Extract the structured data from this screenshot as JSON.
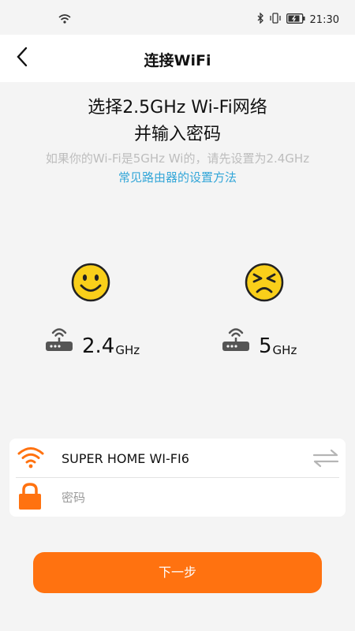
{
  "status_bar": {
    "time": "21:30",
    "icons": [
      "wifi-icon",
      "bluetooth-icon",
      "vibrate-icon",
      "battery-charging-icon"
    ]
  },
  "nav": {
    "title": "连接WiFi",
    "back_icon": "chevron-left-icon"
  },
  "instructions": {
    "heading_line1": "选择2.5GHz Wi-Fi网络",
    "heading_line2": "并输入密码",
    "hint": "如果你的Wi-Fi是5GHz Wi的，请先设置为2.4GHz",
    "guide_link": "常见路由器的设置方法"
  },
  "bands": [
    {
      "value": "2.4",
      "unit": "GHz",
      "status": "supported",
      "face_icon": "smile-face-icon"
    },
    {
      "value": "5",
      "unit": "GHz",
      "status": "unsupported",
      "face_icon": "frown-face-icon"
    }
  ],
  "form": {
    "ssid": "SUPER HOME WI-FI6",
    "password_placeholder": "密码",
    "password_value": ""
  },
  "colors": {
    "accent": "#ff7210",
    "link": "#33a6d8",
    "face": "#f9cf1a"
  },
  "actions": {
    "next_label": "下一步"
  }
}
